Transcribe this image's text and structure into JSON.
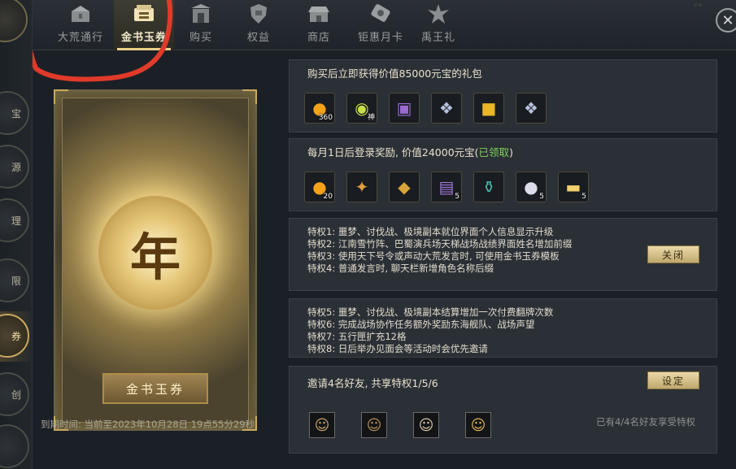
{
  "tabs": [
    {
      "label": "大荒通行",
      "icon": "chest-icon",
      "active": false
    },
    {
      "label": "金书玉券",
      "icon": "gold-book-icon",
      "active": true
    },
    {
      "label": "购买",
      "icon": "gate-icon",
      "active": false
    },
    {
      "label": "权益",
      "icon": "shield-icon",
      "active": false
    },
    {
      "label": "商店",
      "icon": "shop-icon",
      "active": false
    },
    {
      "label": "钜惠月卡",
      "icon": "card-icon",
      "active": false
    },
    {
      "label": "禹王礼",
      "icon": "emblem-icon",
      "active": false
    }
  ],
  "sidebar": {
    "items": [
      {
        "label": "宝",
        "active": false
      },
      {
        "label": "源",
        "active": false
      },
      {
        "label": "理",
        "active": false
      },
      {
        "label": "限",
        "active": false
      },
      {
        "label": "券",
        "active": true
      },
      {
        "label": "创",
        "active": false
      },
      {
        "label": "",
        "active": false
      }
    ]
  },
  "card": {
    "seal_char": "年",
    "banner_label": "金书玉券"
  },
  "expire": {
    "text": "到期时间: 当前至2023年10月28日 19点55分29秒"
  },
  "purchase_section": {
    "title": "购买后立即获得价值85000元宝的礼包",
    "items": [
      {
        "icon": "gold-orb-icon",
        "glyph": "●",
        "color": "#f3a21a",
        "qty": "360"
      },
      {
        "icon": "divine-orb-icon",
        "glyph": "◉",
        "color": "#c9e04a",
        "qty": "神"
      },
      {
        "icon": "purple-chest-icon",
        "glyph": "▣",
        "color": "#9b6bd3",
        "qty": ""
      },
      {
        "icon": "silver-box-icon",
        "glyph": "❖",
        "color": "#b7c3de",
        "qty": ""
      },
      {
        "icon": "gold-chest-icon",
        "glyph": "■",
        "color": "#e8b628",
        "qty": ""
      },
      {
        "icon": "silver-box-icon",
        "glyph": "❖",
        "color": "#b7c3de",
        "qty": ""
      }
    ]
  },
  "monthly_section": {
    "title_prefix": "每月1日后登录奖励, 价值24000元宝(",
    "claimed": "已领取",
    "title_suffix": ")",
    "items": [
      {
        "icon": "gold-orb-icon",
        "glyph": "●",
        "color": "#f3a21a",
        "qty": "20"
      },
      {
        "icon": "crystal-gift-icon",
        "glyph": "✦",
        "color": "#e0a040",
        "qty": ""
      },
      {
        "icon": "gold-token-icon",
        "glyph": "◆",
        "color": "#d6a43a",
        "qty": ""
      },
      {
        "icon": "purple-scroll-icon",
        "glyph": "▤",
        "color": "#a27ad8",
        "qty": "5"
      },
      {
        "icon": "jade-vase-icon",
        "glyph": "⚱",
        "color": "#3fb3a3",
        "qty": ""
      },
      {
        "icon": "pearl-icon",
        "glyph": "●",
        "color": "#dcdcea",
        "qty": "5"
      },
      {
        "icon": "gold-ingot-icon",
        "glyph": "▬",
        "color": "#f0d06a",
        "qty": "5"
      }
    ]
  },
  "privileges_a": {
    "lines": [
      "特权1: 噩梦、讨伐战、极境副本就位界面个人信息显示升级",
      "特权2: 江南雪竹阵、巴蜀演兵场天梯战场战绩界面姓名增加前缀",
      "特权3: 使用天下号令或声动大荒发言时, 可使用金书玉券模板",
      "特权4: 普通发言时, 聊天栏新增角色名称后缀"
    ],
    "button_label": "关闭"
  },
  "privileges_b": {
    "lines": [
      "特权5: 噩梦、讨伐战、极境副本结算增加一次付费翻牌次数",
      "特权6: 完成战场协作任务额外奖励东海舰队、战场声望",
      "特权7: 五行匣扩充12格",
      "特权8: 日后举办见面会等活动时会优先邀请"
    ]
  },
  "invite_section": {
    "title": "邀请4名好友, 共享特权1/5/6",
    "button_label": "设定",
    "note": "已有4/4名好友享受特权",
    "avatars": [
      {
        "icon": "friend-avatar-icon",
        "glyph": "☺"
      },
      {
        "icon": "friend-avatar-icon",
        "glyph": "☺"
      },
      {
        "icon": "friend-avatar-icon",
        "glyph": "☺"
      },
      {
        "icon": "friend-avatar-icon",
        "glyph": "☺"
      }
    ]
  },
  "colors": {
    "accent_gold": "#e8cf8a",
    "claimed_green": "#7fd25a",
    "annotation_red": "#e03a2a"
  }
}
